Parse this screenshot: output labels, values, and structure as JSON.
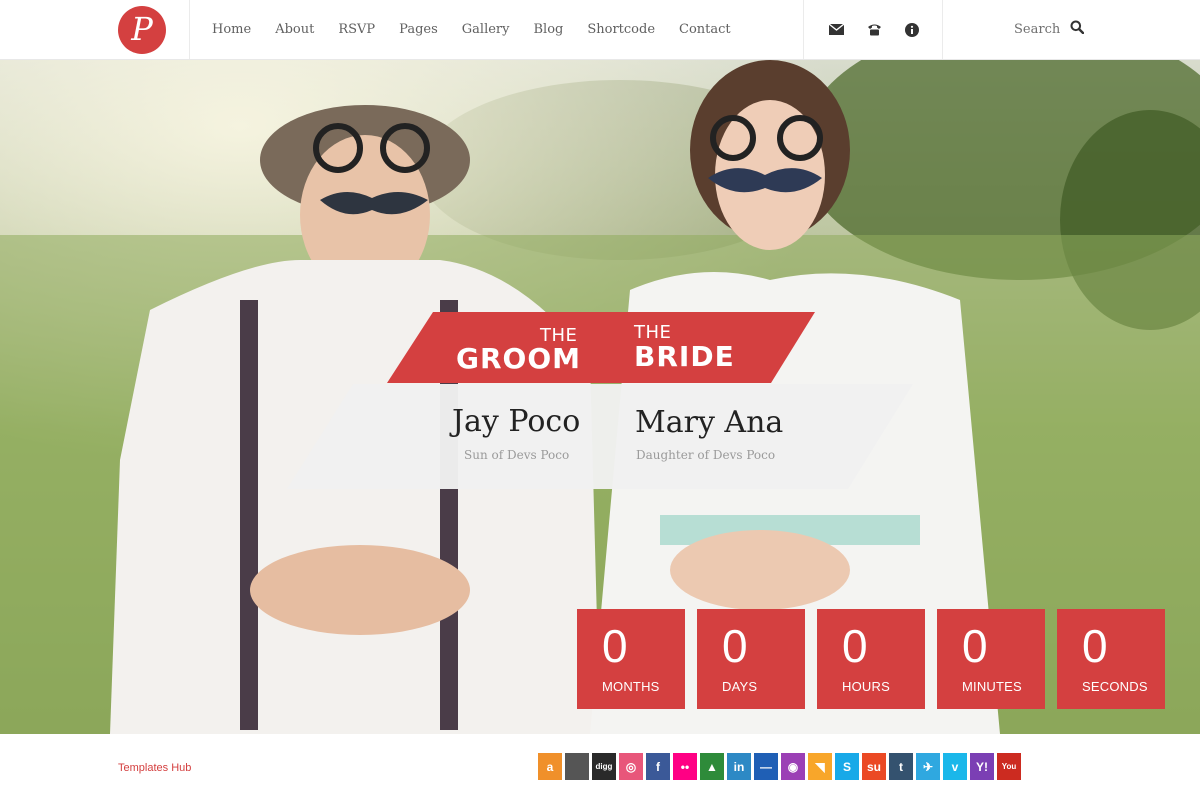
{
  "header": {
    "logo_letter": "P",
    "nav": [
      "Home",
      "About",
      "RSVP",
      "Pages",
      "Gallery",
      "Blog",
      "Shortcode",
      "Contact"
    ],
    "contact_icons": [
      "envelope-icon",
      "phone-icon",
      "info-icon"
    ],
    "search_label": "Search"
  },
  "couple": {
    "groom": {
      "label_small": "THE",
      "label_big": "GROOM",
      "name": "Jay Poco",
      "subtitle": "Sun of Devs Poco"
    },
    "bride": {
      "label_small": "THE",
      "label_big": "BRIDE",
      "name": "Mary Ana",
      "subtitle": "Daughter of Devs Poco"
    }
  },
  "countdown": [
    {
      "value": "0",
      "label": "MONTHS"
    },
    {
      "value": "0",
      "label": "DAYS"
    },
    {
      "value": "0",
      "label": "HOURS"
    },
    {
      "value": "0",
      "label": "MINUTES"
    },
    {
      "value": "0",
      "label": "SECONDS"
    }
  ],
  "footer": {
    "link": "Templates Hub",
    "socials": [
      {
        "name": "amazon-icon",
        "glyph": "a",
        "color": "#f0902a"
      },
      {
        "name": "apple-icon",
        "glyph": "",
        "color": "#555555"
      },
      {
        "name": "digg-icon",
        "glyph": "digg",
        "color": "#2a2a2a"
      },
      {
        "name": "dribbble-icon",
        "glyph": "◎",
        "color": "#e8567a"
      },
      {
        "name": "facebook-icon",
        "glyph": "f",
        "color": "#3b5998"
      },
      {
        "name": "flickr-icon",
        "glyph": "••",
        "color": "#ff0084"
      },
      {
        "name": "forrst-icon",
        "glyph": "▲",
        "color": "#2e8b3a"
      },
      {
        "name": "linkedin-icon",
        "glyph": "in",
        "color": "#2d89c5"
      },
      {
        "name": "delicious-icon",
        "glyph": "—",
        "color": "#1f5fb5"
      },
      {
        "name": "picasa-icon",
        "glyph": "◉",
        "color": "#9b3fb5"
      },
      {
        "name": "rss-icon",
        "glyph": "◥",
        "color": "#f8a62a"
      },
      {
        "name": "skype-icon",
        "glyph": "S",
        "color": "#18a9e8"
      },
      {
        "name": "stumbleupon-icon",
        "glyph": "su",
        "color": "#eb4924"
      },
      {
        "name": "tumblr-icon",
        "glyph": "t",
        "color": "#34526f"
      },
      {
        "name": "twitter-icon",
        "glyph": "✈",
        "color": "#2fa8e0"
      },
      {
        "name": "vimeo-icon",
        "glyph": "v",
        "color": "#1ab7ea"
      },
      {
        "name": "yahoo-icon",
        "glyph": "Y!",
        "color": "#7b3fb4"
      },
      {
        "name": "youtube-icon",
        "glyph": "You",
        "color": "#cc2b20"
      }
    ]
  },
  "colors": {
    "accent": "#d44040",
    "panel": "#f1f1f1"
  }
}
